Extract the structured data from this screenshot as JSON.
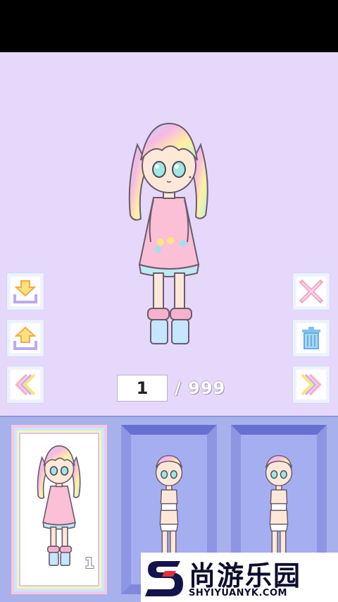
{
  "counter": {
    "current_page": "1",
    "total_label": "/ 999"
  },
  "outfit_slots": [
    {
      "index": "1",
      "selected": true
    },
    {
      "index": "",
      "selected": false
    },
    {
      "index": "",
      "selected": false
    }
  ],
  "buttons": {
    "left": [
      "download-icon",
      "upload-icon",
      "double-chevron-left-icon"
    ],
    "right": [
      "close-icon",
      "trash-icon",
      "double-chevron-right-icon"
    ]
  },
  "watermark": {
    "brand": "尚游乐园",
    "url": "SHYIYUANYK.COM"
  },
  "colors": {
    "stage_bg": "#e6d8fb",
    "tray_bg": "#a9b1ec",
    "frame_blue": "#7f88dd"
  }
}
